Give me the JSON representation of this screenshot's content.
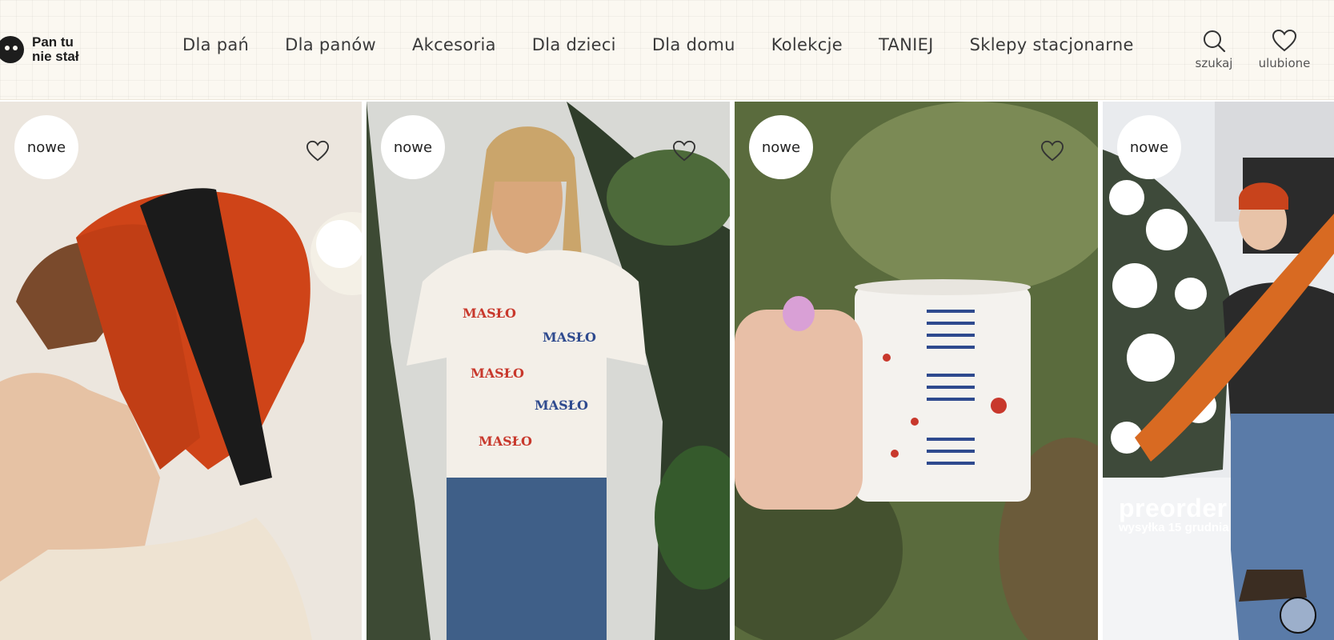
{
  "header": {
    "logo_line1": "Pan tu",
    "logo_line2": "nie stał",
    "nav": [
      "Dla pań",
      "Dla panów",
      "Akcesoria",
      "Dla dzieci",
      "Dla domu",
      "Kolekcje",
      "TANIEJ",
      "Sklepy stacjonarne"
    ],
    "search_label": "szukaj",
    "favorites_label": "ulubione"
  },
  "products": [
    {
      "badge": "nowe",
      "image": "orange knit beanie with pompom on model"
    },
    {
      "badge": "nowe",
      "image": "woman in white t-shirt with Masło Maślane print"
    },
    {
      "badge": "nowe",
      "image": "hand holding calendar mug"
    },
    {
      "badge": "nowe",
      "preorder_title": "preorder",
      "preorder_sub": "wysyłka 15 grudnia"
    }
  ],
  "colors": {
    "header_bg": "#fbf8f1",
    "accent_orange": "#d3471d"
  },
  "icons": {
    "search": "search-icon",
    "favorites": "heart-icon"
  }
}
